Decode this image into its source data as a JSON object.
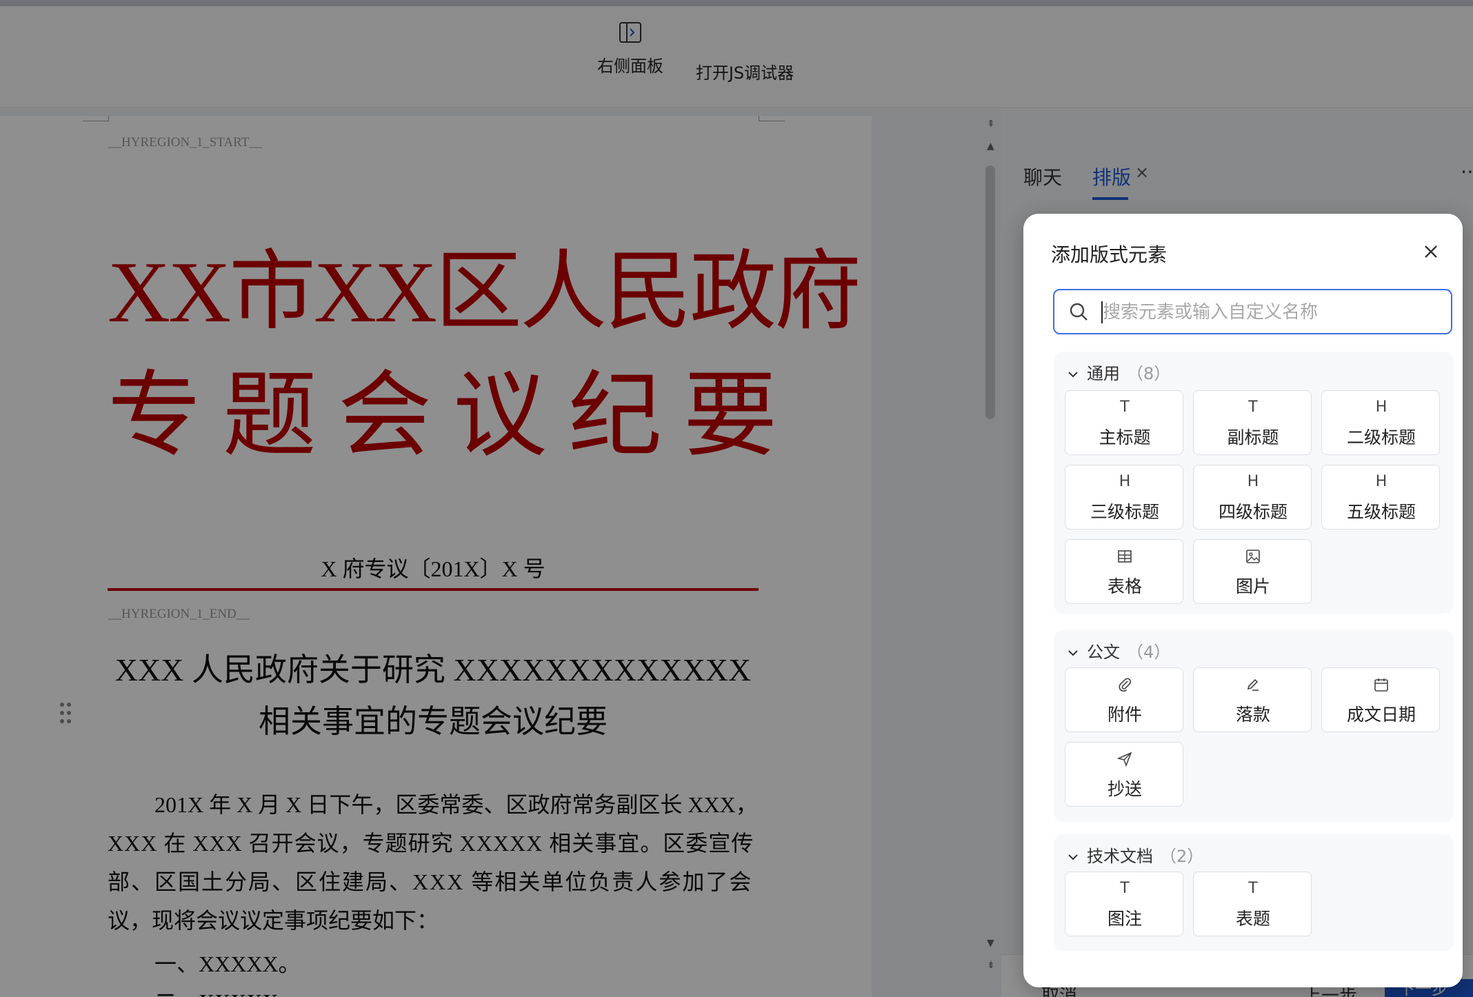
{
  "ribbon": {
    "right_panel_label": "右侧面板",
    "js_debugger_label": "打开JS调试器"
  },
  "document": {
    "region_start_marker": "__HYREGION_1_START__",
    "region_end_marker": "__HYREGION_1_END__",
    "masthead_line1": "XX市XX区人民政府",
    "masthead_line2": "专题会议纪要",
    "doc_number": "X 府专议〔201X〕X 号",
    "heading_line1": "XXX 人民政府关于研究 XXXXXXXXXXXXX",
    "heading_line2": "相关事宜的专题会议纪要",
    "para_lines": [
      "201X 年 X 月 X 日下午，区委常委、区政府常务副区长 XXX，",
      "XXX 在 XXX 召开会议，专题研究 XXXXX 相关事宜。区委宣传",
      "部、区国土分局、区住建局、XXX 等相关单位负责人参加了会",
      "议，现将会议议定事项纪要如下："
    ],
    "list_item_1": "一、XXXXX。",
    "list_item_2": "二、XXXXX"
  },
  "side_panel": {
    "tab_chat": "聊天",
    "tab_layout": "排版",
    "tab_close": "×",
    "more": "⋯",
    "cancel_label": "取消",
    "prev_label": "上一步",
    "next_label": "下一步"
  },
  "modal": {
    "title": "添加版式元素",
    "search_placeholder": "搜索元素或输入自定义名称",
    "search_value": "",
    "groups": [
      {
        "name": "通用",
        "count": "（8）",
        "items": [
          {
            "label": "主标题",
            "icon": "T"
          },
          {
            "label": "副标题",
            "icon": "T"
          },
          {
            "label": "二级标题",
            "icon": "H"
          },
          {
            "label": "三级标题",
            "icon": "H"
          },
          {
            "label": "四级标题",
            "icon": "H"
          },
          {
            "label": "五级标题",
            "icon": "H"
          },
          {
            "label": "表格",
            "icon": "table-icon"
          },
          {
            "label": "图片",
            "icon": "image-icon"
          }
        ]
      },
      {
        "name": "公文",
        "count": "（4）",
        "items": [
          {
            "label": "附件",
            "icon": "paperclip-icon"
          },
          {
            "label": "落款",
            "icon": "pen-icon"
          },
          {
            "label": "成文日期",
            "icon": "calendar-icon"
          },
          {
            "label": "抄送",
            "icon": "send-icon"
          }
        ]
      },
      {
        "name": "技术文档",
        "count": "（2）",
        "items": [
          {
            "label": "图注",
            "icon": "T"
          },
          {
            "label": "表题",
            "icon": "T"
          }
        ]
      }
    ]
  },
  "colors": {
    "masthead_red": "#c00000",
    "accent_blue": "#1f5ad6",
    "overlay": "rgba(0,0,0,0.44)"
  }
}
